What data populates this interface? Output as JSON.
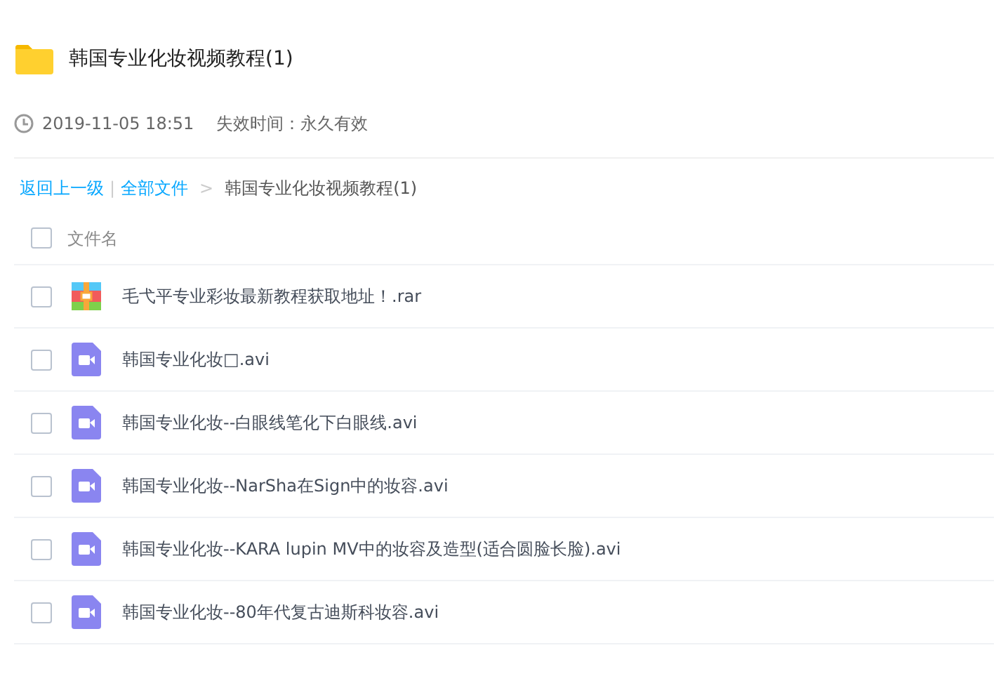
{
  "folder": {
    "title": "韩国专业化妆视频教程(1)"
  },
  "meta": {
    "date": "2019-11-05 18:51",
    "expiry": "失效时间：永久有效"
  },
  "breadcrumb": {
    "back": "返回上一级",
    "separator": "|",
    "root": "全部文件",
    "arrow": ">",
    "current": "韩国专业化妆视频教程(1)"
  },
  "header": {
    "checked": false,
    "label": "文件名"
  },
  "files": [
    {
      "name": "毛弋平专业彩妆最新教程获取地址！.rar",
      "kind": "archive",
      "checked": false
    },
    {
      "name": "韩国专业化妆□.avi",
      "kind": "video",
      "checked": false
    },
    {
      "name": "韩国专业化妆--白眼线笔化下白眼线.avi",
      "kind": "video",
      "checked": false
    },
    {
      "name": "韩国专业化妆--NarSha在Sign中的妆容.avi",
      "kind": "video",
      "checked": false
    },
    {
      "name": "韩国专业化妆--KARA lupin MV中的妆容及造型(适合圆脸长脸).avi",
      "kind": "video",
      "checked": false
    },
    {
      "name": "韩国专业化妆--80年代复古迪斯科妆容.avi",
      "kind": "video",
      "checked": false
    }
  ]
}
